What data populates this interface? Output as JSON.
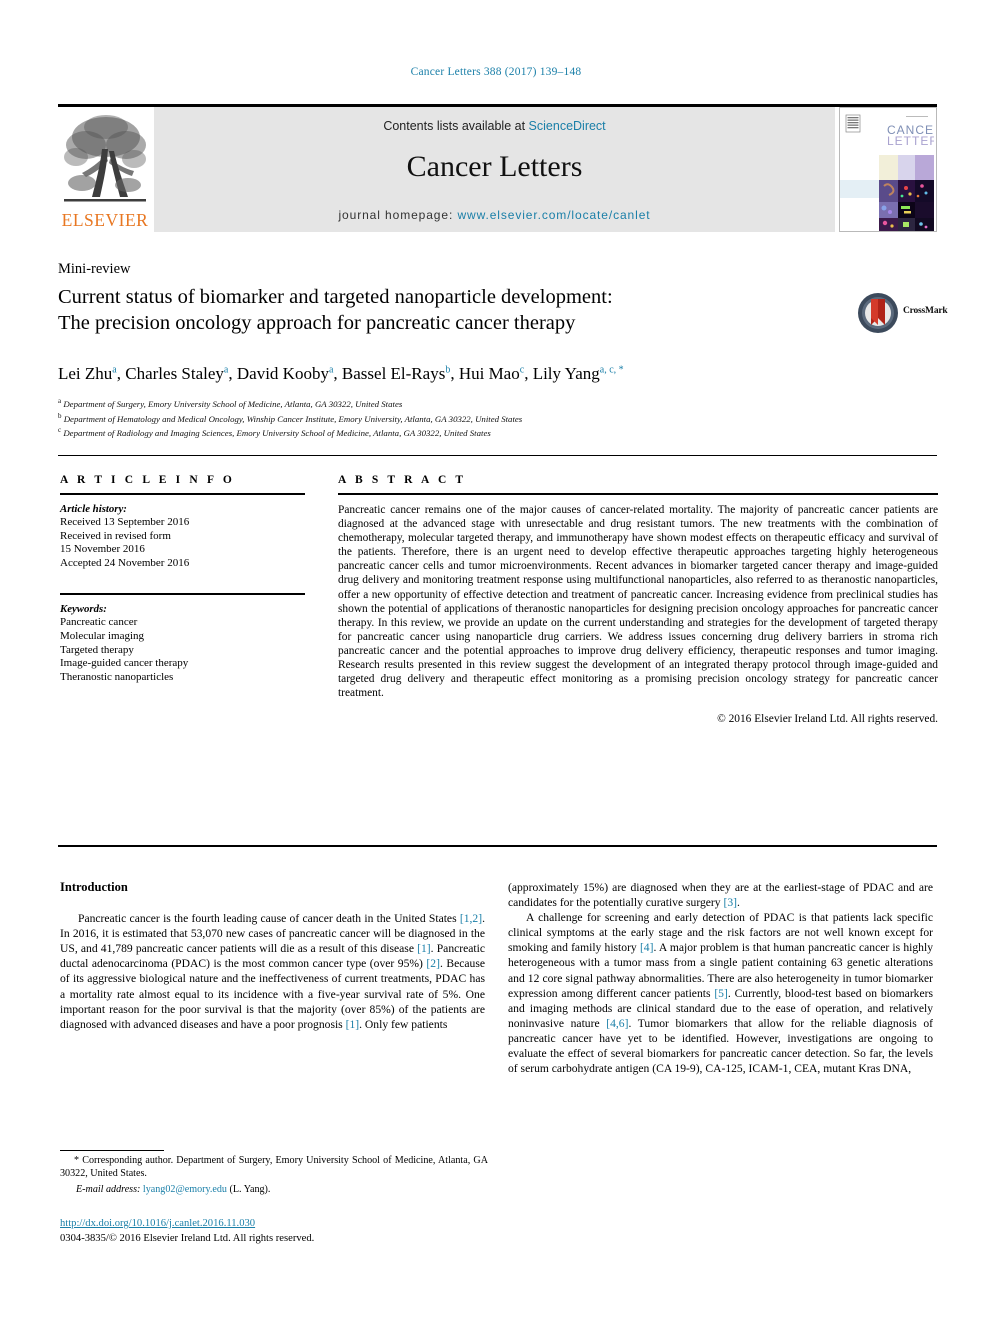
{
  "running_head": "Cancer Letters 388 (2017) 139–148",
  "masthead": {
    "publisher_name": "ELSEVIER",
    "publisher_logo_icon": "elsevier-tree-icon",
    "contents_prefix": "Contents lists available at",
    "contents_link": "ScienceDirect",
    "journal_title": "Cancer Letters",
    "homepage_prefix": "journal homepage:",
    "homepage_url": "www.elsevier.com/locate/canlet",
    "cover": {
      "line1": "CANCER",
      "line2": "LETTERS"
    }
  },
  "article": {
    "type": "Mini-review",
    "title_line1": "Current status of biomarker and targeted nanoparticle development:",
    "title_line2": "The precision oncology approach for pancreatic cancer therapy",
    "crossmark_label": "CrossMark",
    "crossmark_icon": "crossmark-badge-icon"
  },
  "authors": [
    {
      "name": "Lei Zhu",
      "sup": "a"
    },
    {
      "name": "Charles Staley",
      "sup": "a"
    },
    {
      "name": "David Kooby",
      "sup": "a"
    },
    {
      "name": "Bassel El-Rays",
      "sup": "b"
    },
    {
      "name": "Hui Mao",
      "sup": "c"
    },
    {
      "name": "Lily Yang",
      "sup": "a, c, *"
    }
  ],
  "affiliations": [
    {
      "marker": "a",
      "text": "Department of Surgery, Emory University School of Medicine, Atlanta, GA 30322, United States"
    },
    {
      "marker": "b",
      "text": "Department of Hematology and Medical Oncology, Winship Cancer Institute, Emory University, Atlanta, GA 30322, United States"
    },
    {
      "marker": "c",
      "text": "Department of Radiology and Imaging Sciences, Emory University School of Medicine, Atlanta, GA 30322, United States"
    }
  ],
  "article_info": {
    "heading": "A R T I C L E   I N F O",
    "history_label": "Article history:",
    "history": [
      "Received 13 September 2016",
      "Received in revised form",
      "15 November 2016",
      "Accepted 24 November 2016"
    ],
    "keywords_label": "Keywords:",
    "keywords": [
      "Pancreatic cancer",
      "Molecular imaging",
      "Targeted therapy",
      "Image-guided cancer therapy",
      "Theranostic nanoparticles"
    ]
  },
  "abstract": {
    "heading": "A B S T R A C T",
    "text": "Pancreatic cancer remains one of the major causes of cancer-related mortality. The majority of pancreatic cancer patients are diagnosed at the advanced stage with unresectable and drug resistant tumors. The new treatments with the combination of chemotherapy, molecular targeted therapy, and immunotherapy have shown modest effects on therapeutic efficacy and survival of the patients. Therefore, there is an urgent need to develop effective therapeutic approaches targeting highly heterogeneous pancreatic cancer cells and tumor microenvironments. Recent advances in biomarker targeted cancer therapy and image-guided drug delivery and monitoring treatment response using multifunctional nanoparticles, also referred to as theranostic nanoparticles, offer a new opportunity of effective detection and treatment of pancreatic cancer. Increasing evidence from preclinical studies has shown the potential of applications of theranostic nanoparticles for designing precision oncology approaches for pancreatic cancer therapy. In this review, we provide an update on the current understanding and strategies for the development of targeted therapy for pancreatic cancer using nanoparticle drug carriers. We address issues concerning drug delivery barriers in stroma rich pancreatic cancer and the potential approaches to improve drug delivery efficiency, therapeutic responses and tumor imaging. Research results presented in this review suggest the development of an integrated therapy protocol through image-guided and targeted drug delivery and therapeutic effect monitoring as a promising precision oncology strategy for pancreatic cancer treatment.",
    "copyright": "© 2016 Elsevier Ireland Ltd. All rights reserved."
  },
  "body": {
    "intro_heading": "Introduction",
    "left_paragraph_1_a": "Pancreatic cancer is the fourth leading cause of cancer death in the United States ",
    "left_ref_1": "[1,2]",
    "left_paragraph_1_b": ". In 2016, it is estimated that 53,070 new cases of pancreatic cancer will be diagnosed in the US, and 41,789 pancreatic cancer patients will die as a result of this disease ",
    "left_ref_2": "[1]",
    "left_paragraph_1_c": ". Pancreatic ductal adenocarcinoma (PDAC) is the most common cancer type (over 95%) ",
    "left_ref_3": "[2]",
    "left_paragraph_1_d": ". Because of its aggressive biological nature and the ineffectiveness of current treatments, PDAC has a mortality rate almost equal to its incidence with a five-year survival rate of 5%. One important reason for the poor survival is that the majority (over 85%) of the patients are diagnosed with advanced diseases and have a poor prognosis ",
    "left_ref_4": "[1]",
    "left_paragraph_1_e": ". Only few patients",
    "right_paragraph_1_a": "(approximately 15%) are diagnosed when they are at the earliest-stage of PDAC and are candidates for the potentially curative surgery ",
    "right_ref_1": "[3]",
    "right_paragraph_1_b": ".",
    "right_paragraph_2_a": "A challenge for screening and early detection of PDAC is that patients lack specific clinical symptoms at the early stage and the risk factors are not well known except for smoking and family history ",
    "right_ref_2": "[4]",
    "right_paragraph_2_b": ". A major problem is that human pancreatic cancer is highly heterogeneous with a tumor mass from a single patient containing 63 genetic alterations and 12 core signal pathway abnormalities. There are also heterogeneity in tumor biomarker expression among different cancer patients ",
    "right_ref_3": "[5]",
    "right_paragraph_2_c": ". Currently, blood-test based on biomarkers and imaging methods are clinical standard due to the ease of operation, and relatively noninvasive nature ",
    "right_ref_4": "[4,6]",
    "right_paragraph_2_d": ". Tumor biomarkers that allow for the reliable diagnosis of pancreatic cancer have yet to be identified. However, investigations are ongoing to evaluate the effect of several biomarkers for pancreatic cancer detection. So far, the levels of serum carbohydrate antigen (CA 19-9), CA-125, ICAM-1, CEA, mutant Kras DNA,"
  },
  "footnotes": {
    "corresponding_marker": "*",
    "corresponding_text": "Corresponding author. Department of Surgery, Emory University School of Medicine, Atlanta, GA 30322, United States.",
    "email_label": "E-mail address:",
    "email": "lyang02@emory.edu",
    "email_suffix": "(L. Yang)."
  },
  "doi": "http://dx.doi.org/10.1016/j.canlet.2016.11.030",
  "issn_line": "0304-3835/© 2016 Elsevier Ireland Ltd. All rights reserved.",
  "colors": {
    "link": "#1a7fa8",
    "elsevier_orange": "#E87722",
    "banner_gray": "#e5e5e5"
  }
}
